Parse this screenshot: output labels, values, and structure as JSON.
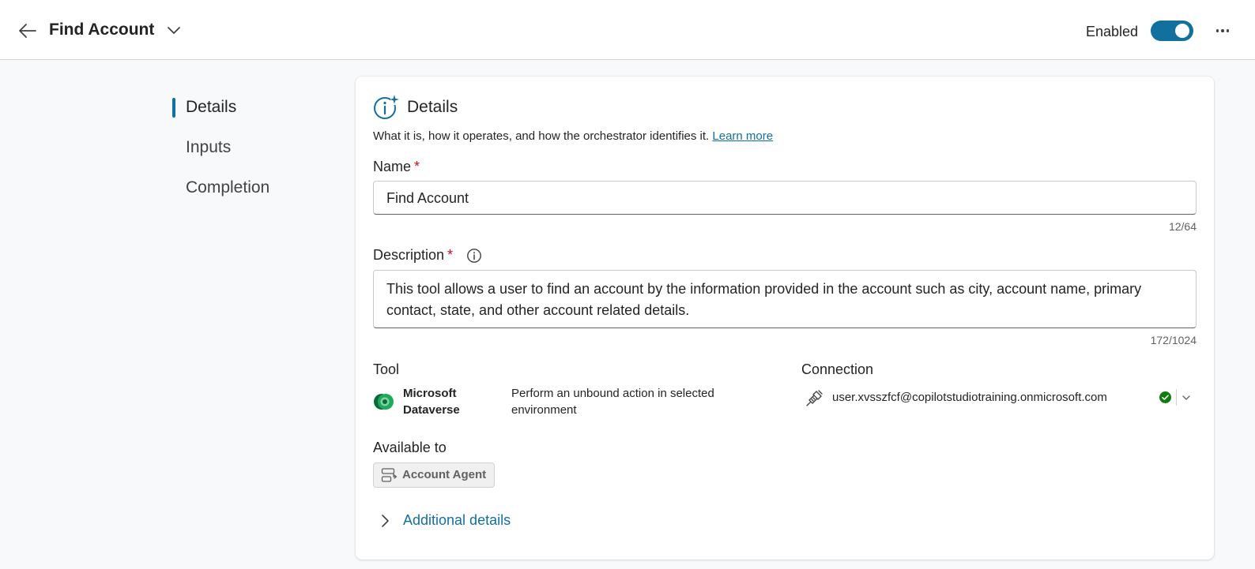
{
  "header": {
    "title": "Find Account",
    "enabled_label": "Enabled",
    "enabled": true,
    "back_icon": "arrow-left-icon",
    "more_icon": "more-horizontal-icon"
  },
  "nav": {
    "items": [
      {
        "label": "Details",
        "active": true
      },
      {
        "label": "Inputs",
        "active": false
      },
      {
        "label": "Completion",
        "active": false
      }
    ]
  },
  "details": {
    "title": "Details",
    "subtitle": "What it is, how it operates, and how the orchestrator identifies it.",
    "learn_more": "Learn more",
    "name_label": "Name",
    "name_value": "Find Account",
    "name_counter": "12/64",
    "description_label": "Description",
    "description_value": "This tool allows a user to find an account by the information provided in the account such as city, account name, primary contact, state, and other account related details.",
    "description_counter": "172/1024",
    "required_marker": "*"
  },
  "tool": {
    "label": "Tool",
    "name": "Microsoft Dataverse",
    "action": "Perform an unbound action in selected environment"
  },
  "connection": {
    "label": "Connection",
    "account": "user.xvsszfcf@copilotstudiotraining.onmicrosoft.com",
    "status_color": "#107c10"
  },
  "available_to": {
    "label": "Available to",
    "agent": "Account Agent"
  },
  "additional": {
    "label": "Additional details"
  },
  "colors": {
    "accent": "#11709e",
    "required": "#c50f1f"
  }
}
